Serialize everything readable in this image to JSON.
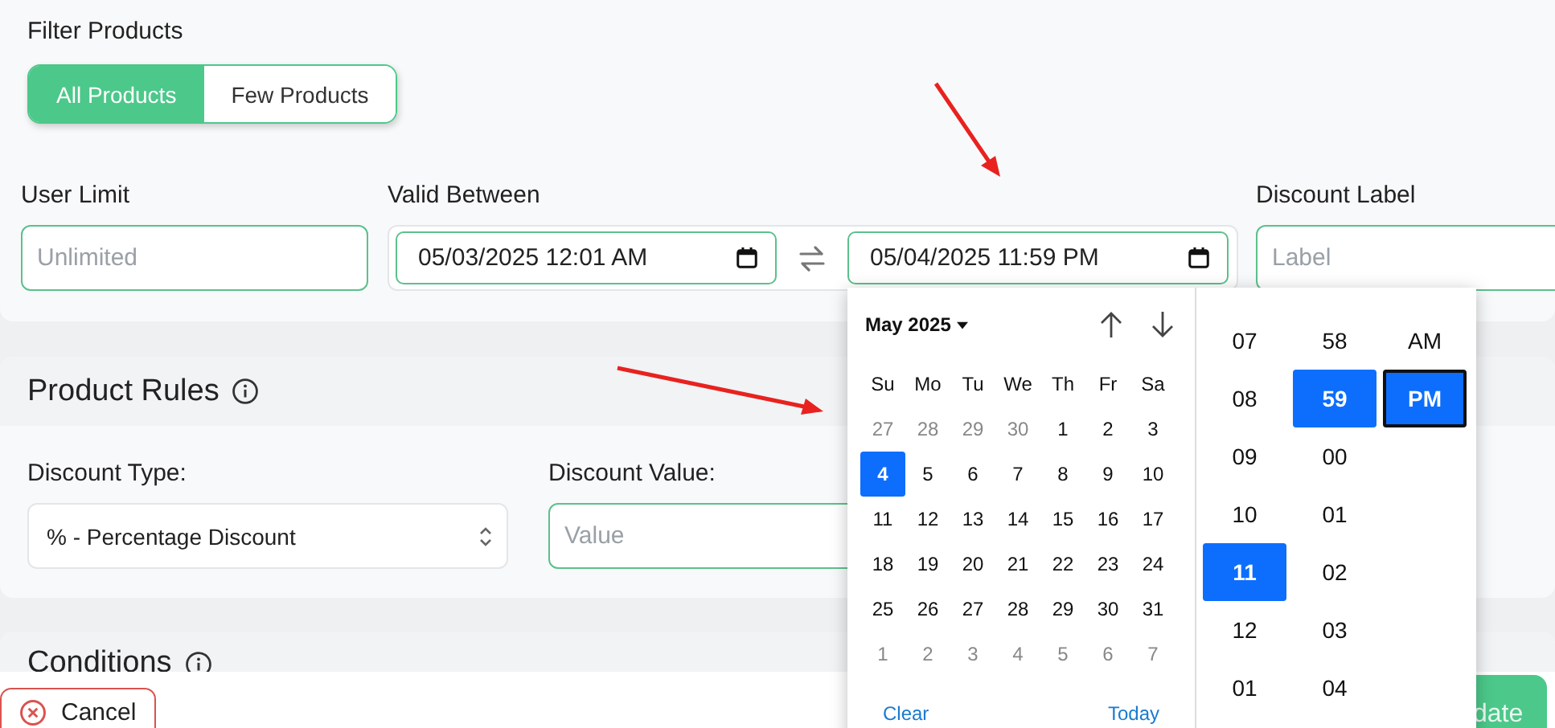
{
  "filter_products": {
    "label": "Filter Products",
    "options": [
      {
        "label": "All Products",
        "selected": true
      },
      {
        "label": "Few Products",
        "selected": false
      }
    ]
  },
  "user_limit": {
    "label": "User Limit",
    "placeholder": "Unlimited"
  },
  "valid_between": {
    "label": "Valid Between",
    "start": "05/03/2025 12:01 AM",
    "end": "05/04/2025 11:59 PM"
  },
  "discount_label": {
    "label": "Discount Label",
    "placeholder": "Label"
  },
  "product_rules": {
    "title": "Product Rules",
    "discount_type": {
      "label": "Discount Type:",
      "value": "% - Percentage Discount"
    },
    "discount_value": {
      "label": "Discount Value:",
      "placeholder": "Value"
    }
  },
  "conditions": {
    "title": "Conditions"
  },
  "footer": {
    "cancel": "Cancel",
    "submit": "date"
  },
  "picker": {
    "month": "May 2025",
    "weekdays": [
      "Su",
      "Mo",
      "Tu",
      "We",
      "Th",
      "Fr",
      "Sa"
    ],
    "days": [
      {
        "label": "27",
        "outside": true,
        "selected": false
      },
      {
        "label": "28",
        "outside": true,
        "selected": false
      },
      {
        "label": "29",
        "outside": true,
        "selected": false
      },
      {
        "label": "30",
        "outside": true,
        "selected": false
      },
      {
        "label": "1",
        "outside": false,
        "selected": false
      },
      {
        "label": "2",
        "outside": false,
        "selected": false
      },
      {
        "label": "3",
        "outside": false,
        "selected": false
      },
      {
        "label": "4",
        "outside": false,
        "selected": true
      },
      {
        "label": "5",
        "outside": false,
        "selected": false
      },
      {
        "label": "6",
        "outside": false,
        "selected": false
      },
      {
        "label": "7",
        "outside": false,
        "selected": false
      },
      {
        "label": "8",
        "outside": false,
        "selected": false
      },
      {
        "label": "9",
        "outside": false,
        "selected": false
      },
      {
        "label": "10",
        "outside": false,
        "selected": false
      },
      {
        "label": "11",
        "outside": false,
        "selected": false
      },
      {
        "label": "12",
        "outside": false,
        "selected": false
      },
      {
        "label": "13",
        "outside": false,
        "selected": false
      },
      {
        "label": "14",
        "outside": false,
        "selected": false
      },
      {
        "label": "15",
        "outside": false,
        "selected": false
      },
      {
        "label": "16",
        "outside": false,
        "selected": false
      },
      {
        "label": "17",
        "outside": false,
        "selected": false
      },
      {
        "label": "18",
        "outside": false,
        "selected": false
      },
      {
        "label": "19",
        "outside": false,
        "selected": false
      },
      {
        "label": "20",
        "outside": false,
        "selected": false
      },
      {
        "label": "21",
        "outside": false,
        "selected": false
      },
      {
        "label": "22",
        "outside": false,
        "selected": false
      },
      {
        "label": "23",
        "outside": false,
        "selected": false
      },
      {
        "label": "24",
        "outside": false,
        "selected": false
      },
      {
        "label": "25",
        "outside": false,
        "selected": false
      },
      {
        "label": "26",
        "outside": false,
        "selected": false
      },
      {
        "label": "27",
        "outside": false,
        "selected": false
      },
      {
        "label": "28",
        "outside": false,
        "selected": false
      },
      {
        "label": "29",
        "outside": false,
        "selected": false
      },
      {
        "label": "30",
        "outside": false,
        "selected": false
      },
      {
        "label": "31",
        "outside": false,
        "selected": false
      },
      {
        "label": "1",
        "outside": true,
        "selected": false
      },
      {
        "label": "2",
        "outside": true,
        "selected": false
      },
      {
        "label": "3",
        "outside": true,
        "selected": false
      },
      {
        "label": "4",
        "outside": true,
        "selected": false
      },
      {
        "label": "5",
        "outside": true,
        "selected": false
      },
      {
        "label": "6",
        "outside": true,
        "selected": false
      },
      {
        "label": "7",
        "outside": true,
        "selected": false
      }
    ],
    "clear": "Clear",
    "today": "Today",
    "time_columns": [
      [
        {
          "label": "07",
          "selected": false,
          "focused": false
        },
        {
          "label": "08",
          "selected": false,
          "focused": false
        },
        {
          "label": "09",
          "selected": false,
          "focused": false
        },
        {
          "label": "10",
          "selected": false,
          "focused": false
        },
        {
          "label": "11",
          "selected": true,
          "focused": false
        },
        {
          "label": "12",
          "selected": false,
          "focused": false
        },
        {
          "label": "01",
          "selected": false,
          "focused": false
        }
      ],
      [
        {
          "label": "58",
          "selected": false,
          "focused": false
        },
        {
          "label": "59",
          "selected": true,
          "focused": false
        },
        {
          "label": "00",
          "selected": false,
          "focused": false
        },
        {
          "label": "01",
          "selected": false,
          "focused": false
        },
        {
          "label": "02",
          "selected": false,
          "focused": false
        },
        {
          "label": "03",
          "selected": false,
          "focused": false
        },
        {
          "label": "04",
          "selected": false,
          "focused": false
        }
      ],
      [
        {
          "label": "AM",
          "selected": false,
          "focused": false
        },
        {
          "label": "PM",
          "selected": true,
          "focused": true
        }
      ]
    ]
  }
}
